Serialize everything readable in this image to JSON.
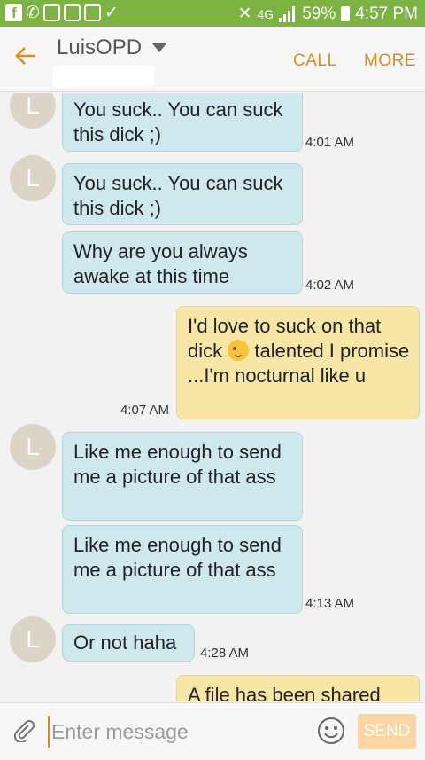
{
  "status_bar": {
    "network_label": "4G",
    "battery": "59%",
    "time": "4:57 PM"
  },
  "header": {
    "contact_name": "LuisOPD",
    "call_label": "CALL",
    "more_label": "MORE"
  },
  "messages": [
    {
      "avatar": "L",
      "text": "You suck.. You can suck this dick ;)",
      "time": "4:01 AM"
    },
    {
      "avatar": "L",
      "text": "You suck.. You can suck this dick ;)",
      "time": ""
    },
    {
      "text": "Why are you always awake at this time",
      "time": "4:02 AM"
    },
    {
      "text_before_emoji": "I'd love to suck on that dick",
      "text_after_emoji": "talented I promise ...I'm nocturnal like u",
      "emoji": "winking-face",
      "time": "4:07 AM"
    },
    {
      "avatar": "L",
      "text": "Like me enough to send me a picture of that ass",
      "time": ""
    },
    {
      "text": "Like me enough to send me a picture of that ass",
      "time": "4:13 AM"
    },
    {
      "avatar": "L",
      "text": "Or not haha",
      "time": "4:28 AM"
    },
    {
      "text": "A file has been shared",
      "time": ""
    }
  ],
  "composer": {
    "placeholder": "Enter message",
    "send_label": "SEND"
  },
  "icons": {
    "back": "arrow-left-icon",
    "attach": "paperclip-icon",
    "emoji": "smiley-icon"
  },
  "colors": {
    "status_bar": "#7cb342",
    "accent": "#e08a1e",
    "incoming_bubble": "#cfe8ee",
    "outgoing_bubble": "#f8e6a6",
    "avatar": "#dcd4c6"
  }
}
